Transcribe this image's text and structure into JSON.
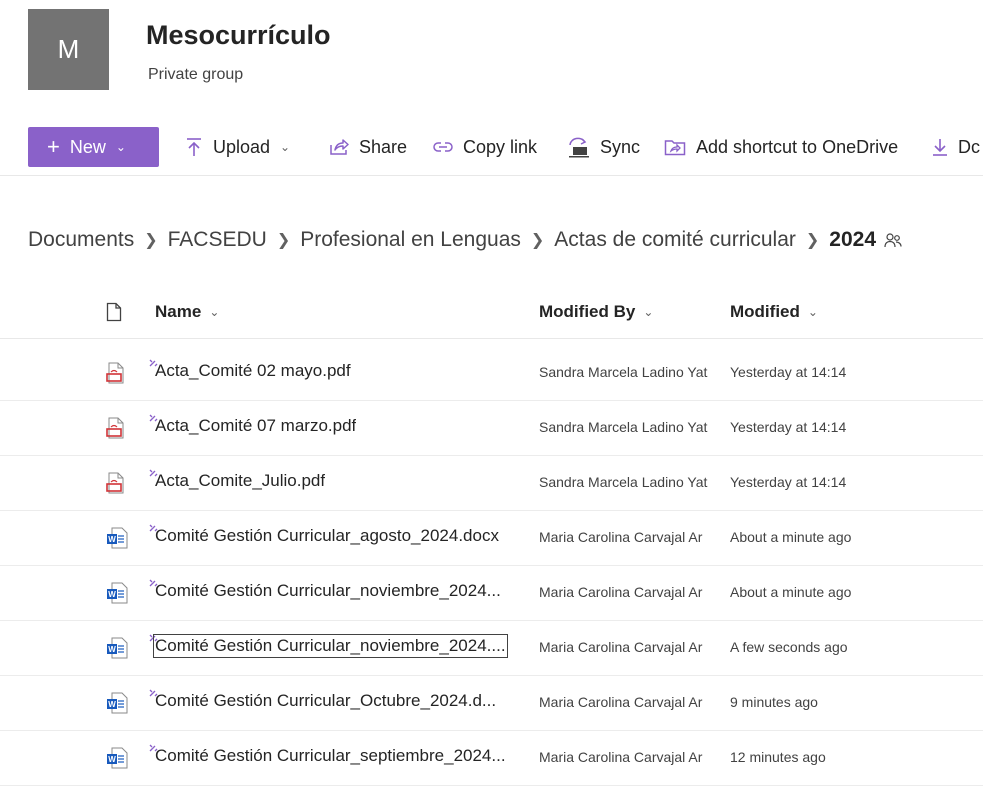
{
  "group": {
    "avatar_letter": "M",
    "title": "Mesocurrículo",
    "subtitle": "Private group"
  },
  "toolbar": {
    "new_label": "New",
    "upload_label": "Upload",
    "share_label": "Share",
    "copy_link_label": "Copy link",
    "sync_label": "Sync",
    "shortcut_label": "Add shortcut to OneDrive",
    "download_label": "Dc",
    "accent_color": "#8a61c9"
  },
  "breadcrumb": [
    "Documents",
    "FACSEDU",
    "Profesional en Lenguas",
    "Actas de comité curricular"
  ],
  "breadcrumb_current": "2024",
  "columns": {
    "name": "Name",
    "modified_by": "Modified By",
    "modified": "Modified"
  },
  "files": [
    {
      "name": "Acta_Comité 02 mayo.pdf",
      "type": "pdf",
      "modified_by": "Sandra Marcela Ladino Yat",
      "modified": "Yesterday at 14:14"
    },
    {
      "name": "Acta_Comité 07 marzo.pdf",
      "type": "pdf",
      "modified_by": "Sandra Marcela Ladino Yat",
      "modified": "Yesterday at 14:14"
    },
    {
      "name": "Acta_Comite_Julio.pdf",
      "type": "pdf",
      "modified_by": "Sandra Marcela Ladino Yat",
      "modified": "Yesterday at 14:14"
    },
    {
      "name": "Comité Gestión Curricular_agosto_2024.docx",
      "type": "docx",
      "modified_by": "Maria Carolina Carvajal Ar",
      "modified": "About a minute ago"
    },
    {
      "name": "Comité Gestión Curricular_noviembre_2024...",
      "type": "docx",
      "modified_by": "Maria Carolina Carvajal Ar",
      "modified": "About a minute ago"
    },
    {
      "name": "Comité Gestión Curricular_noviembre_2024....",
      "type": "docx",
      "modified_by": "Maria Carolina Carvajal Ar",
      "modified": "A few seconds ago"
    },
    {
      "name": "Comité Gestión Curricular_Octubre_2024.d...",
      "type": "docx",
      "modified_by": "Maria Carolina Carvajal Ar",
      "modified": "9 minutes ago"
    },
    {
      "name": "Comité Gestión Curricular_septiembre_2024...",
      "type": "docx",
      "modified_by": "Maria Carolina Carvajal Ar",
      "modified": "12 minutes ago"
    }
  ]
}
